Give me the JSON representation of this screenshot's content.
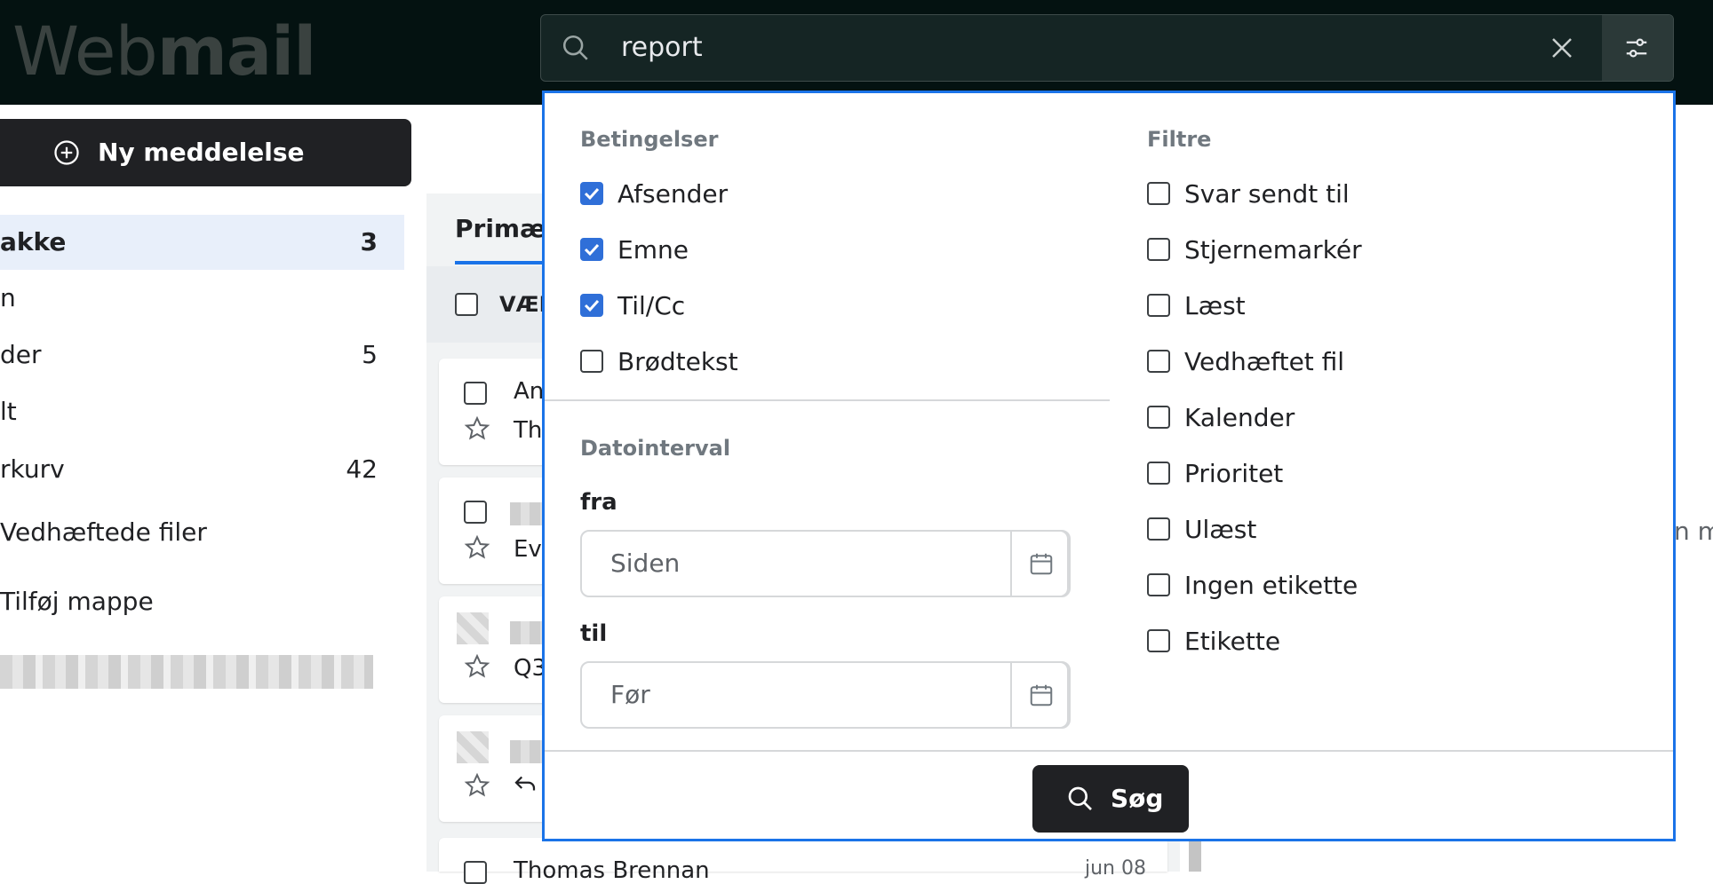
{
  "app": {
    "logo_light": "Web",
    "logo_bold": "mail"
  },
  "search": {
    "query": "report",
    "icons": [
      "search-icon",
      "close-icon",
      "tune-icon"
    ]
  },
  "sidebar": {
    "new_message": "Ny meddelelse",
    "items": [
      {
        "label": "akke",
        "count": "3",
        "active": true
      },
      {
        "label": "n",
        "count": ""
      },
      {
        "label": "der",
        "count": "5"
      },
      {
        "label": "lt",
        "count": ""
      },
      {
        "label": "rkurv",
        "count": "42"
      },
      {
        "label": "Vedhæftede filer",
        "count": ""
      },
      {
        "label": "Tilføj mappe",
        "count": ""
      }
    ]
  },
  "list": {
    "tab_primary": "Primær",
    "select_label": "VÆL",
    "rows": [
      {
        "name": "An",
        "subject": "Th"
      },
      {
        "name": "",
        "subject": "Ev"
      },
      {
        "name": "",
        "subject": "Q3"
      },
      {
        "name": "",
        "subject": ""
      },
      {
        "name": "Thomas Brennan",
        "subject": "",
        "date": "jun 08"
      }
    ],
    "right_fragment": "n m"
  },
  "filter_panel": {
    "conditions_header": "Betingelser",
    "conditions": [
      {
        "label": "Afsender",
        "checked": true
      },
      {
        "label": "Emne",
        "checked": true
      },
      {
        "label": "Til/Cc",
        "checked": true
      },
      {
        "label": "Brødtekst",
        "checked": false
      }
    ],
    "date_header": "Datointerval",
    "from_label": "fra",
    "from_placeholder": "Siden",
    "to_label": "til",
    "to_placeholder": "Før",
    "filters_header": "Filtre",
    "filters": [
      {
        "label": "Svar sendt til",
        "checked": false
      },
      {
        "label": "Stjernemarkér",
        "checked": false
      },
      {
        "label": "Læst",
        "checked": false
      },
      {
        "label": "Vedhæftet fil",
        "checked": false
      },
      {
        "label": "Kalender",
        "checked": false
      },
      {
        "label": "Prioritet",
        "checked": false
      },
      {
        "label": "Ulæst",
        "checked": false
      },
      {
        "label": "Ingen etikette",
        "checked": false
      },
      {
        "label": "Etikette",
        "checked": false
      }
    ],
    "search_button": "Søg"
  },
  "colors": {
    "accent": "#1a73e8",
    "checkbox": "#2f6fd8",
    "topbar": "#041211",
    "button": "#202124"
  }
}
